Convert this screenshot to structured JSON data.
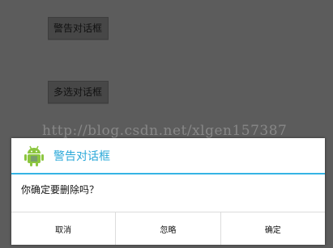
{
  "background_buttons": [
    {
      "label": "警告对话框"
    },
    {
      "label": "多选对话框"
    }
  ],
  "watermark": "http://blog.csdn.net/xlgen157387",
  "dialog": {
    "icon": "android-icon",
    "title": "警告对话框",
    "message": "你确定要删除吗？",
    "buttons": [
      {
        "label": "取消"
      },
      {
        "label": "忽略"
      },
      {
        "label": "确定"
      }
    ]
  },
  "colors": {
    "background": "#5c5c5c",
    "dialog_title": "#2aa8d8",
    "divider": "#35b4e4",
    "android_green": "#8cc63f"
  }
}
